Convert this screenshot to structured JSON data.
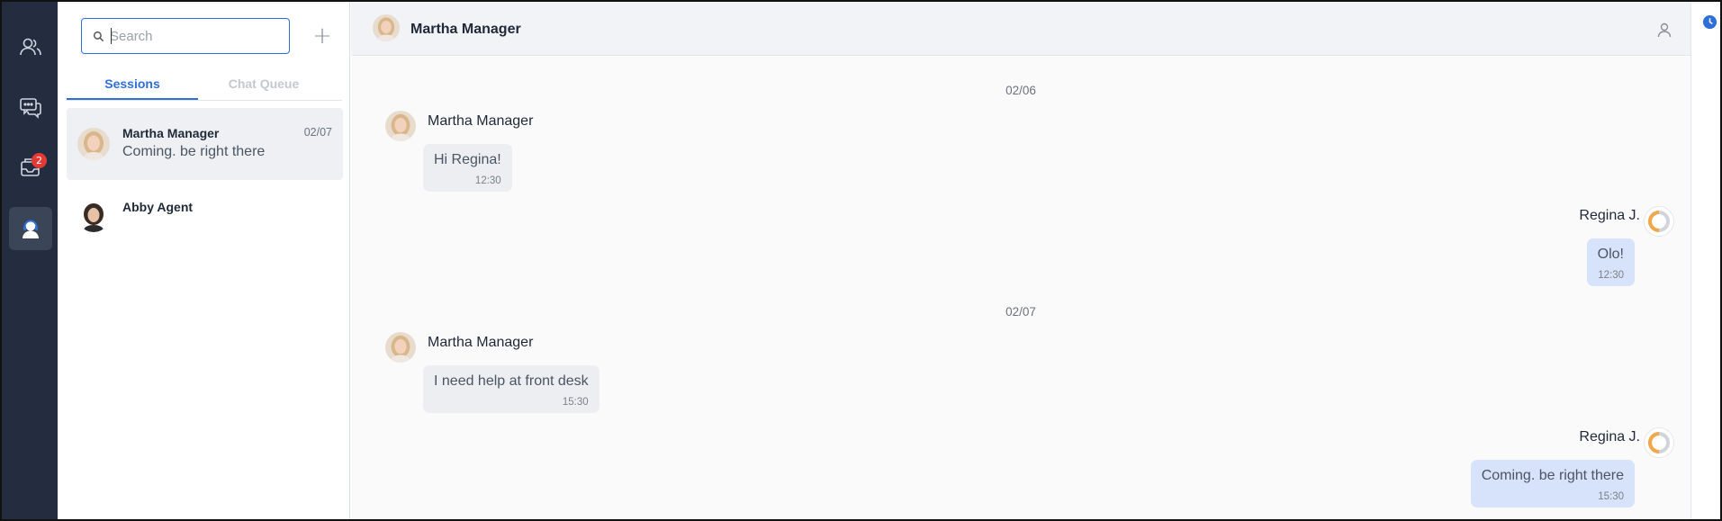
{
  "nav": {
    "items": [
      {
        "icon": "contacts-icon"
      },
      {
        "icon": "chat-bubbles-icon"
      },
      {
        "icon": "inbox-icon",
        "badge": "2"
      },
      {
        "icon": "agent-headset-icon",
        "active": true
      }
    ]
  },
  "sessions_panel": {
    "search_placeholder": "Search",
    "add_icon": "plus-icon",
    "tabs": [
      {
        "label": "Sessions",
        "active": true
      },
      {
        "label": "Chat Queue",
        "active": false
      }
    ],
    "sessions": [
      {
        "name": "Martha Manager",
        "date": "02/07",
        "preview": "Coming. be right there",
        "selected": true
      },
      {
        "name": "Abby Agent",
        "date": "",
        "preview": "",
        "selected": false
      }
    ]
  },
  "chat": {
    "header_title": "Martha Manager",
    "groups": [
      {
        "date": "02/06",
        "messages": [
          {
            "direction": "in",
            "sender": "Martha Manager",
            "text": "Hi Regina!",
            "time": "12:30"
          },
          {
            "direction": "out",
            "sender": "Regina J.",
            "text": "Olo!",
            "time": "12:30"
          }
        ]
      },
      {
        "date": "02/07",
        "messages": [
          {
            "direction": "in",
            "sender": "Martha Manager",
            "text": "I need help at front desk",
            "time": "15:30"
          },
          {
            "direction": "out",
            "sender": "Regina J.",
            "text": "Coming. be right there",
            "time": "15:30"
          }
        ]
      }
    ]
  },
  "colors": {
    "accent": "#2f6fd6",
    "rail": "#232d3f",
    "badge": "#e53935",
    "outgoing_bubble": "#d6e3fa",
    "incoming_bubble": "#eceef1"
  }
}
